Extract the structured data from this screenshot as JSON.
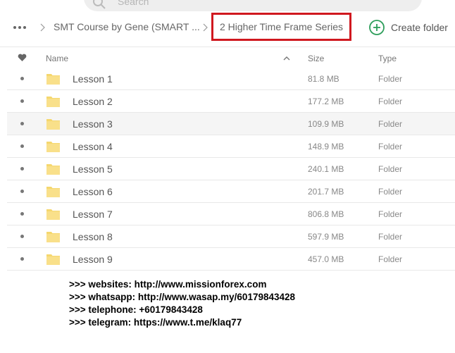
{
  "search": {
    "placeholder": "Search"
  },
  "breadcrumb": {
    "parent": "SMT Course by Gene (SMART ...",
    "current": "2 Higher Time Frame Series"
  },
  "toolbar": {
    "create_folder_label": "Create folder"
  },
  "table": {
    "headers": {
      "name": "Name",
      "size": "Size",
      "type": "Type"
    },
    "rows": [
      {
        "name": "Lesson 1",
        "size": "81.8 MB",
        "type": "Folder"
      },
      {
        "name": "Lesson 2",
        "size": "177.2 MB",
        "type": "Folder"
      },
      {
        "name": "Lesson 3",
        "size": "109.9 MB",
        "type": "Folder"
      },
      {
        "name": "Lesson 4",
        "size": "148.9 MB",
        "type": "Folder"
      },
      {
        "name": "Lesson 5",
        "size": "240.1 MB",
        "type": "Folder"
      },
      {
        "name": "Lesson 6",
        "size": "201.7 MB",
        "type": "Folder"
      },
      {
        "name": "Lesson 7",
        "size": "806.8 MB",
        "type": "Folder"
      },
      {
        "name": "Lesson 8",
        "size": "597.9 MB",
        "type": "Folder"
      },
      {
        "name": "Lesson 9",
        "size": "457.0 MB",
        "type": "Folder"
      }
    ]
  },
  "promo": [
    ">>> websites: http://www.missionforex.com",
    ">>> whatsapp: http://www.wasap.my/60179843428",
    ">>> telephone: +60179843428",
    ">>> telegram: https://www.t.me/klaq77"
  ],
  "colors": {
    "highlight_border": "#d0181f",
    "accent_green": "#2e9e5b",
    "folder_yellow": "#f5d76e"
  },
  "icons": [
    "search-icon",
    "more-icon",
    "chevron-right-icon",
    "plus-circle-icon",
    "heart-icon",
    "sort-up-icon",
    "folder-icon"
  ]
}
